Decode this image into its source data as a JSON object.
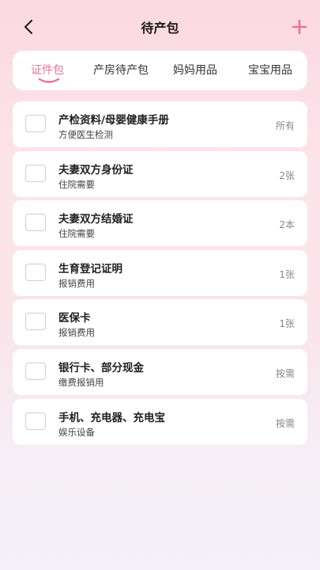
{
  "header": {
    "title": "待产包"
  },
  "colors": {
    "accent": "#e8739a",
    "background_top": "#fcd9e2"
  },
  "tabs": [
    {
      "label": "证件包",
      "active": true
    },
    {
      "label": "产房待产包",
      "active": false
    },
    {
      "label": "妈妈用品",
      "active": false
    },
    {
      "label": "宝宝用品",
      "active": false
    }
  ],
  "items": [
    {
      "title": "产检资料/母婴健康手册",
      "subtitle": "方便医生检测",
      "quantity": "所有",
      "checked": false
    },
    {
      "title": "夫妻双方身份证",
      "subtitle": "住院需要",
      "quantity": "2张",
      "checked": false
    },
    {
      "title": "夫妻双方结婚证",
      "subtitle": "住院需要",
      "quantity": "2本",
      "checked": false
    },
    {
      "title": "生育登记证明",
      "subtitle": "报销费用",
      "quantity": "1张",
      "checked": false
    },
    {
      "title": "医保卡",
      "subtitle": "报销费用",
      "quantity": "1张",
      "checked": false
    },
    {
      "title": "银行卡、部分现金",
      "subtitle": "缴费报销用",
      "quantity": "按需",
      "checked": false
    },
    {
      "title": "手机、充电器、充电宝",
      "subtitle": "娱乐设备",
      "quantity": "按需",
      "checked": false
    }
  ]
}
